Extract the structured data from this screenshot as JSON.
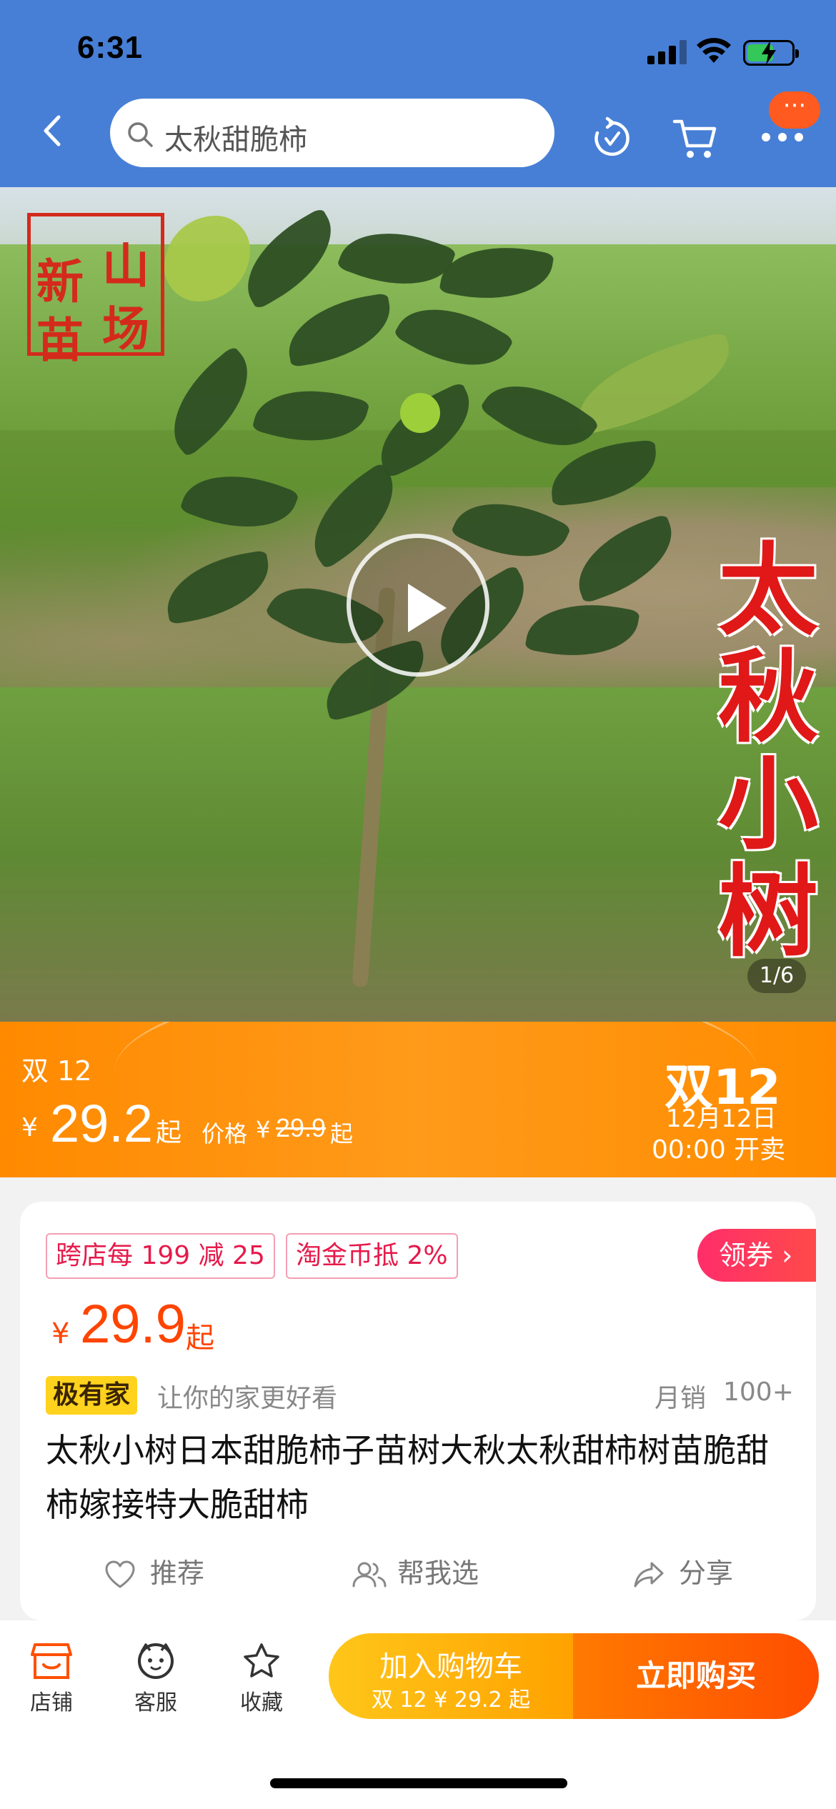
{
  "status_bar": {
    "time": "6:31"
  },
  "header": {
    "search_placeholder": "太秋甜脆柿",
    "more_badge": "···"
  },
  "hero": {
    "stamp_chars": [
      "新",
      "山",
      "苗",
      "场"
    ],
    "overlay_text": [
      "太",
      "秋",
      "小",
      "树"
    ],
    "pager": "1/6"
  },
  "promo": {
    "tag": "双 12",
    "currency": "¥",
    "price": "29.2",
    "price_suffix": "起",
    "orig_label": "价格",
    "orig_currency": "¥",
    "orig_price": "29.9",
    "orig_suffix": "起",
    "event_title": "双12",
    "event_date": "12月12日",
    "event_time": "00:00 开卖"
  },
  "card": {
    "chip1": "跨店每 199 减 25",
    "chip2": "淘金币抵 2%",
    "coupon": "领券 ›",
    "currency": "¥",
    "price": "29.9",
    "price_suffix": "起",
    "brand": "极有家",
    "slogan": "让你的家更好看",
    "sales_label": "月销",
    "sales_value": "100+",
    "title": "太秋小树日本甜脆柿子苗树大秋太秋甜柿树苗脆甜柿嫁接特大脆甜柿",
    "actions": {
      "recommend": "推荐",
      "help_choose": "帮我选",
      "share": "分享"
    }
  },
  "bottom_bar": {
    "shop": "店铺",
    "service": "客服",
    "favorite": "收藏",
    "add_cart": "加入购物车",
    "add_cart_sub": "双 12 ¥ 29.2 起",
    "buy_now": "立即购买"
  },
  "colors": {
    "header_bg": "#477fd6",
    "promo_orange": "#ff8a00",
    "price_red": "#ff4400",
    "chip_red": "#e61a4b",
    "brand_yellow": "#ffd21e"
  },
  "icons": [
    "back-icon",
    "search-icon",
    "refresh-icon",
    "cart-icon",
    "more-icon",
    "play-icon",
    "heart-icon",
    "users-icon",
    "share-icon",
    "shop-icon",
    "service-icon",
    "star-icon"
  ]
}
